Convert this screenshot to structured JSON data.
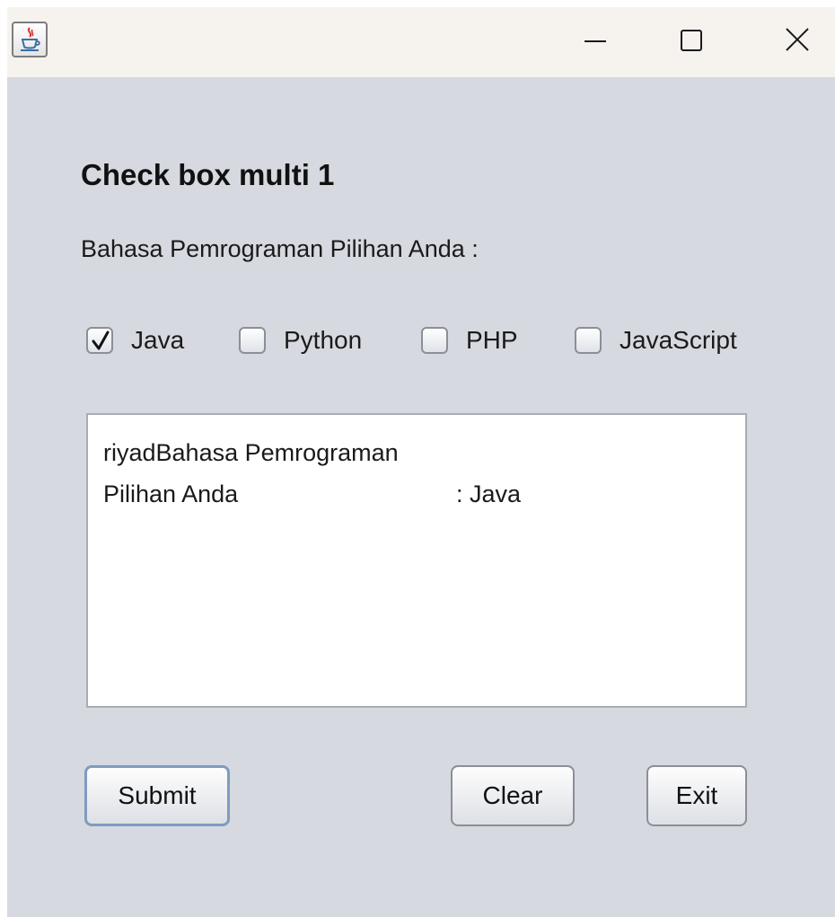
{
  "window": {
    "title": "",
    "icon": "java-coffee-cup-icon"
  },
  "titlebar_controls": {
    "minimize_icon": "minimize-icon",
    "maximize_icon": "maximize-icon",
    "close_icon": "close-icon"
  },
  "form": {
    "title": "Check box multi 1",
    "prompt": "Bahasa Pemrograman Pilihan Anda :",
    "checkboxes": [
      {
        "label": "Java",
        "checked": true
      },
      {
        "label": "Python",
        "checked": false
      },
      {
        "label": "PHP",
        "checked": false
      },
      {
        "label": "JavaScript",
        "checked": false
      }
    ],
    "output": {
      "line1": "riyadBahasa Pemrograman",
      "line2_label": "Pilihan Anda",
      "line2_value": ": Java"
    },
    "buttons": {
      "submit": "Submit",
      "clear": "Clear",
      "exit": "Exit"
    }
  },
  "colors": {
    "window_bg": "#d6d9e0",
    "titlebar_bg": "#f6f3ef",
    "focus_border": "#7e9cc0"
  }
}
